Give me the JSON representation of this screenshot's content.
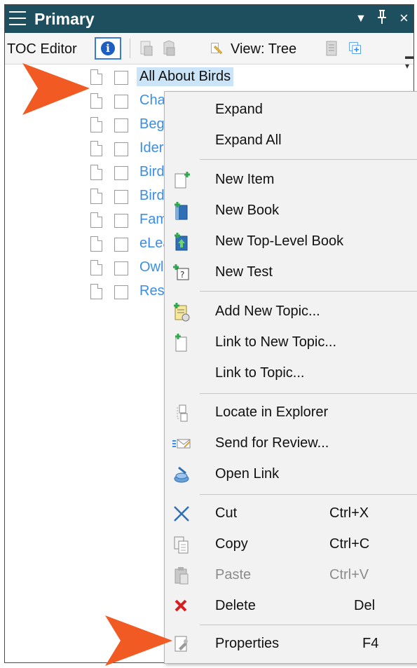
{
  "panel": {
    "title": "Primary",
    "dropdown_icon": "▼",
    "pin_icon": "⊥",
    "close_icon": "×"
  },
  "toolbar": {
    "label": "TOC Editor",
    "view_label": "View: Tree"
  },
  "tree": {
    "items": [
      {
        "label": "All About Birds",
        "selected": true,
        "link": false
      },
      {
        "label": "Cha",
        "link": true
      },
      {
        "label": "Beg",
        "link": true
      },
      {
        "label": "Ider",
        "link": true
      },
      {
        "label": "Bird",
        "link": true
      },
      {
        "label": "Bird",
        "link": true
      },
      {
        "label": "Fam",
        "link": true
      },
      {
        "label": "eLea",
        "link": true
      },
      {
        "label": "Owl",
        "link": true
      },
      {
        "label": "Reso",
        "link": true
      }
    ]
  },
  "context_menu": {
    "items": [
      {
        "label": "Expand"
      },
      {
        "label": "Expand All"
      },
      {
        "label": "New Item",
        "icon": "new-item-icon"
      },
      {
        "label": "New Book",
        "icon": "new-book-icon"
      },
      {
        "label": "New Top-Level Book",
        "icon": "new-top-level-book-icon"
      },
      {
        "label": "New Test",
        "icon": "new-test-icon"
      },
      {
        "label": "Add New Topic...",
        "icon": "add-new-topic-icon"
      },
      {
        "label": "Link to New Topic...",
        "icon": "link-new-topic-icon"
      },
      {
        "label": "Link to Topic..."
      },
      {
        "label": "Locate in Explorer",
        "icon": "locate-explorer-icon"
      },
      {
        "label": "Send for Review...",
        "icon": "send-review-icon"
      },
      {
        "label": "Open Link",
        "icon": "open-link-icon"
      },
      {
        "label": "Cut",
        "shortcut": "Ctrl+X",
        "icon": "cut-icon"
      },
      {
        "label": "Copy",
        "shortcut": "Ctrl+C",
        "icon": "copy-icon"
      },
      {
        "label": "Paste",
        "shortcut": "Ctrl+V",
        "icon": "paste-icon",
        "disabled": true
      },
      {
        "label": "Delete",
        "shortcut": "Del",
        "icon": "delete-icon"
      },
      {
        "label": "Properties",
        "shortcut": "F4",
        "icon": "properties-icon"
      }
    ]
  },
  "colors": {
    "titlebar": "#1e4f5f",
    "link": "#3a8ee6",
    "selection": "#cce4f7",
    "callout_arrow": "#f15a22"
  }
}
